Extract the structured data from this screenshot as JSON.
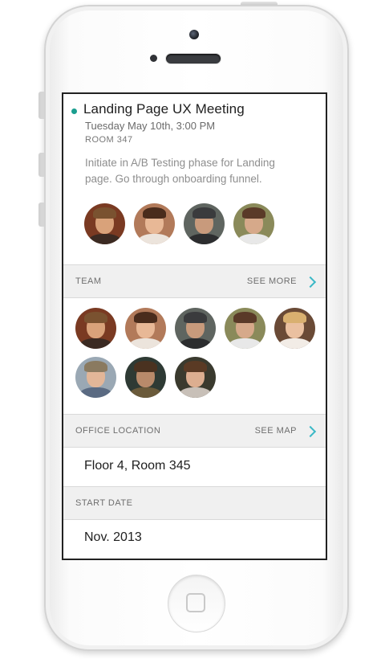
{
  "meeting": {
    "title": "Landing Page UX Meeting",
    "datetime": "Tuesday May 10th, 3:00 PM",
    "room": "ROOM 347",
    "description": "Initiate in A/B Testing phase for Landing page. Go through onboarding funnel.",
    "attendees": [
      {
        "bg": "#7a3a22",
        "skin": "#d9a27a",
        "hair": "#7a5230",
        "shirt": "#3b2a22"
      },
      {
        "bg": "#b27a5a",
        "skin": "#e8b896",
        "hair": "#4a2c1c",
        "shirt": "#ece4dc"
      },
      {
        "bg": "#5f6560",
        "skin": "#c89a7c",
        "hair": "#3a3b3d",
        "shirt": "#2c2d2f"
      },
      {
        "bg": "#8a8a5a",
        "skin": "#d6a98a",
        "hair": "#5a3a28",
        "shirt": "#e8e8e8"
      }
    ]
  },
  "team": {
    "label": "TEAM",
    "link": "SEE MORE",
    "members": [
      {
        "bg": "#7a3a22",
        "skin": "#d9a27a",
        "hair": "#7a5230",
        "shirt": "#3b2a22"
      },
      {
        "bg": "#b27a5a",
        "skin": "#e8b896",
        "hair": "#4a2c1c",
        "shirt": "#ece4dc"
      },
      {
        "bg": "#5f6560",
        "skin": "#c89a7c",
        "hair": "#3a3b3d",
        "shirt": "#2c2d2f"
      },
      {
        "bg": "#8a8a5a",
        "skin": "#d6a98a",
        "hair": "#5a3a28",
        "shirt": "#e8e8e8"
      },
      {
        "bg": "#6a4a36",
        "skin": "#eac0a0",
        "hair": "#d9b070",
        "shirt": "#f2ece6"
      },
      {
        "bg": "#9aa8b4",
        "skin": "#e2b698",
        "hair": "#8a7a60",
        "shirt": "#5a6a82"
      },
      {
        "bg": "#2e3a34",
        "skin": "#b88a6a",
        "hair": "#4a3220",
        "shirt": "#6a5a3a"
      },
      {
        "bg": "#3a3a2e",
        "skin": "#dcae90",
        "hair": "#5a3a24",
        "shirt": "#c8c0b8"
      }
    ]
  },
  "office": {
    "label": "OFFICE LOCATION",
    "link": "SEE MAP",
    "value": "Floor 4, Room 345"
  },
  "start": {
    "label": "START DATE",
    "value": "Nov. 2013"
  },
  "colors": {
    "accent": "#3bb8c6",
    "status_dot": "#1a9e8f"
  }
}
